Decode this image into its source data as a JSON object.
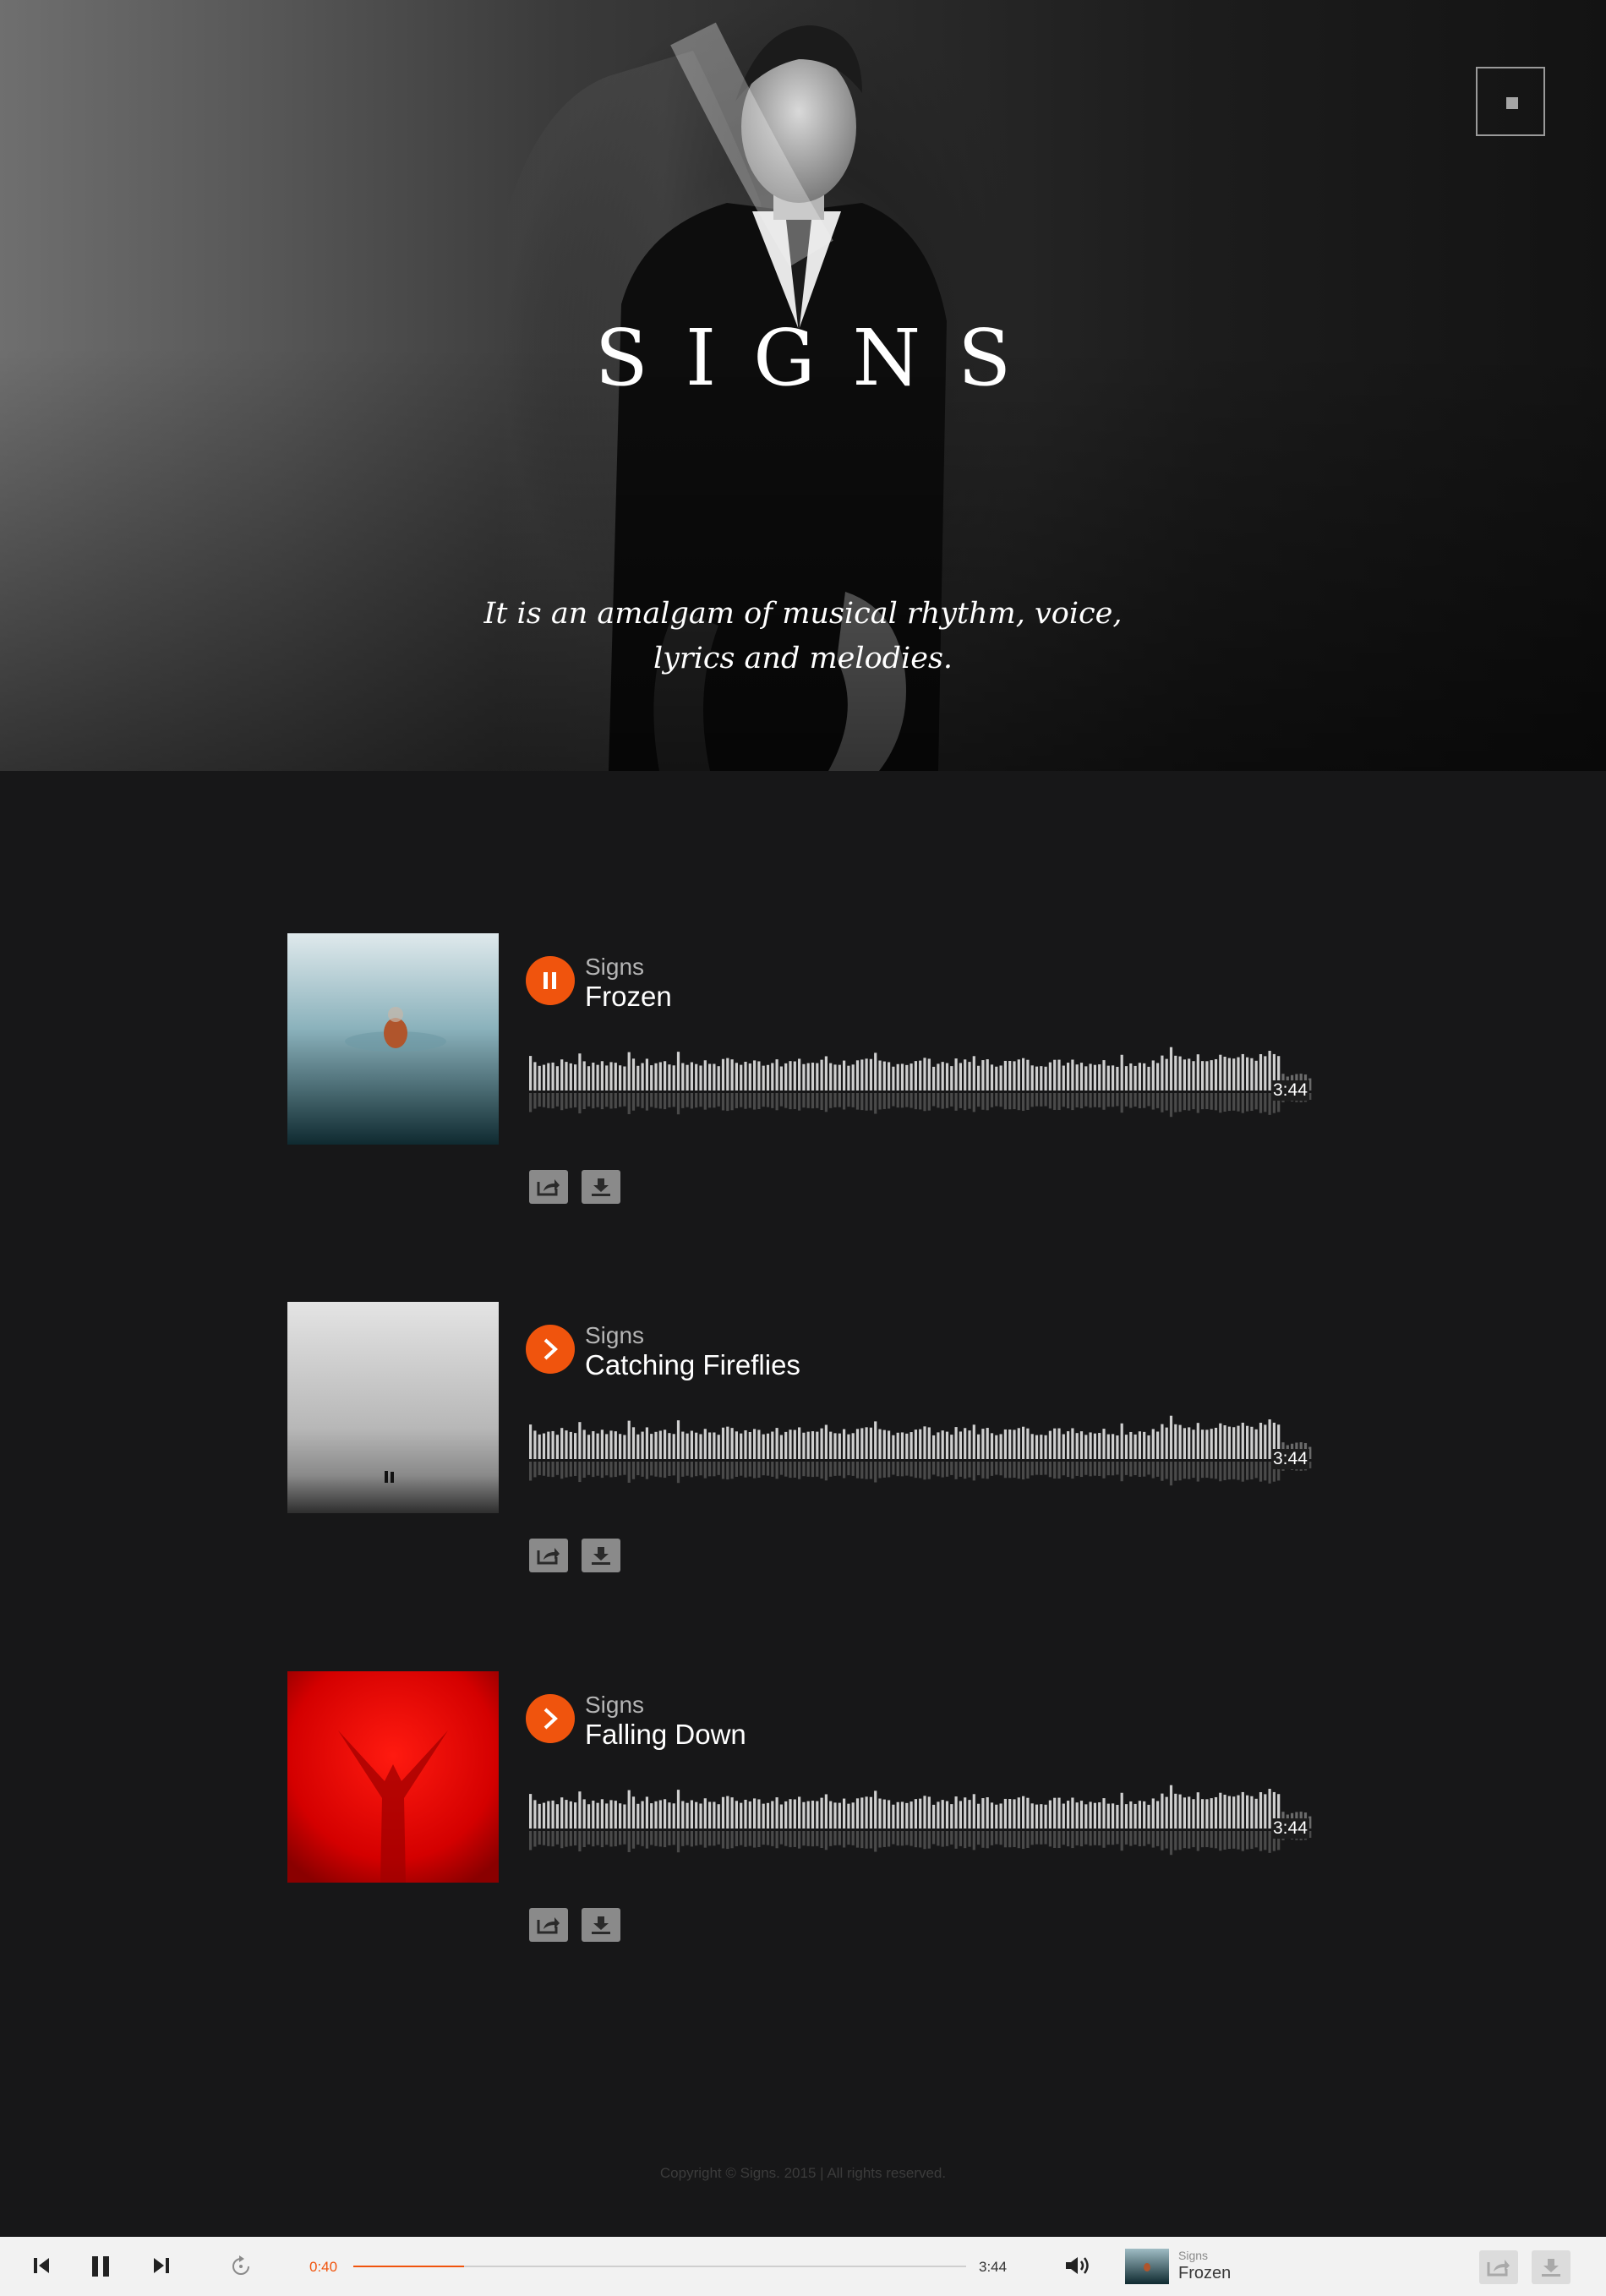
{
  "hero": {
    "title": "SIGNS",
    "tagline_line1": "It is an amalgam of musical rhythm, voice,",
    "tagline_line2": "lyrics and melodies.",
    "menu_icon": "square-menu-icon"
  },
  "tracks": [
    {
      "artist": "Signs",
      "title": "Frozen",
      "duration": "3:44",
      "state": "playing",
      "play_icon": "pause-icon",
      "cover": "foggy-water-figure"
    },
    {
      "artist": "Signs",
      "title": "Catching Fireflies",
      "duration": "3:44",
      "state": "paused",
      "play_icon": "play-icon",
      "cover": "misty-beach-couple"
    },
    {
      "artist": "Signs",
      "title": "Falling Down",
      "duration": "3:44",
      "state": "paused",
      "play_icon": "play-icon",
      "cover": "red-silhouette"
    }
  ],
  "track_actions": {
    "share_icon": "share-icon",
    "download_icon": "download-icon"
  },
  "footer": {
    "copyright": "Copyright © Signs. 2015  |  All rights reserved."
  },
  "player": {
    "current_time": "0:40",
    "total_time": "3:44",
    "progress": 0.18,
    "now_playing_artist": "Signs",
    "now_playing_title": "Frozen",
    "icons": [
      "prev-icon",
      "pause-icon",
      "next-icon",
      "repeat-icon",
      "volume-icon",
      "share-icon",
      "download-icon"
    ]
  },
  "colors": {
    "accent": "#f0540d",
    "background": "#171718",
    "player_bg": "#f2f2f2"
  }
}
